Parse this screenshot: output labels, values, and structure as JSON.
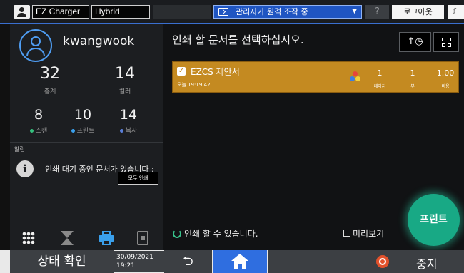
{
  "topbar": {
    "user_icon": "user-icon",
    "app_label": "EZ Charger",
    "mode_label": "Hybrid",
    "remote_status": "관리자가 원격 조작 중",
    "remote_arrow": "▼",
    "help_label": "?",
    "logout_label": "로그아웃",
    "moon_label": "☾"
  },
  "user": {
    "name": "kwangwook",
    "total_value": "32",
    "total_label": "총계",
    "color_value": "14",
    "color_label": "컬러",
    "scan_value": "8",
    "scan_label": "스캔",
    "print_value": "10",
    "print_label": "프린트",
    "copy_value": "14",
    "copy_label": "복사"
  },
  "alert": {
    "title": "알림",
    "message": "인쇄 대기 중인 문서가 있습니다 :",
    "print_all_label": "모두 인쇄"
  },
  "main": {
    "title": "인쇄 할 문서를 선택하십시오.",
    "sort_label": "↑◷"
  },
  "job": {
    "name": "EZCS 제안서",
    "time": "오늘 19:19:42",
    "pages_value": "1",
    "pages_label": "페이지",
    "copies_value": "1",
    "copies_label": "부",
    "cost_value": "1.00",
    "cost_label": "비용",
    "checked": "✓"
  },
  "footer": {
    "ready_text": "인쇄 할 수 있습니다.",
    "preview_label": "미리보기",
    "print_button": "프린트"
  },
  "bottombar": {
    "status_label": "상태 확인",
    "date": "30/09/2021",
    "time": "19:21",
    "back_label": "⮌",
    "stop_label": "중지"
  },
  "colors": {
    "accent": "#2f6ee0",
    "job_row": "#c48a21",
    "print_button": "#18a985",
    "scan_dot": "#35c07e",
    "print_dot": "#3aa0ec",
    "copy_dot": "#5a7fd8",
    "stop": "#e2512b"
  }
}
